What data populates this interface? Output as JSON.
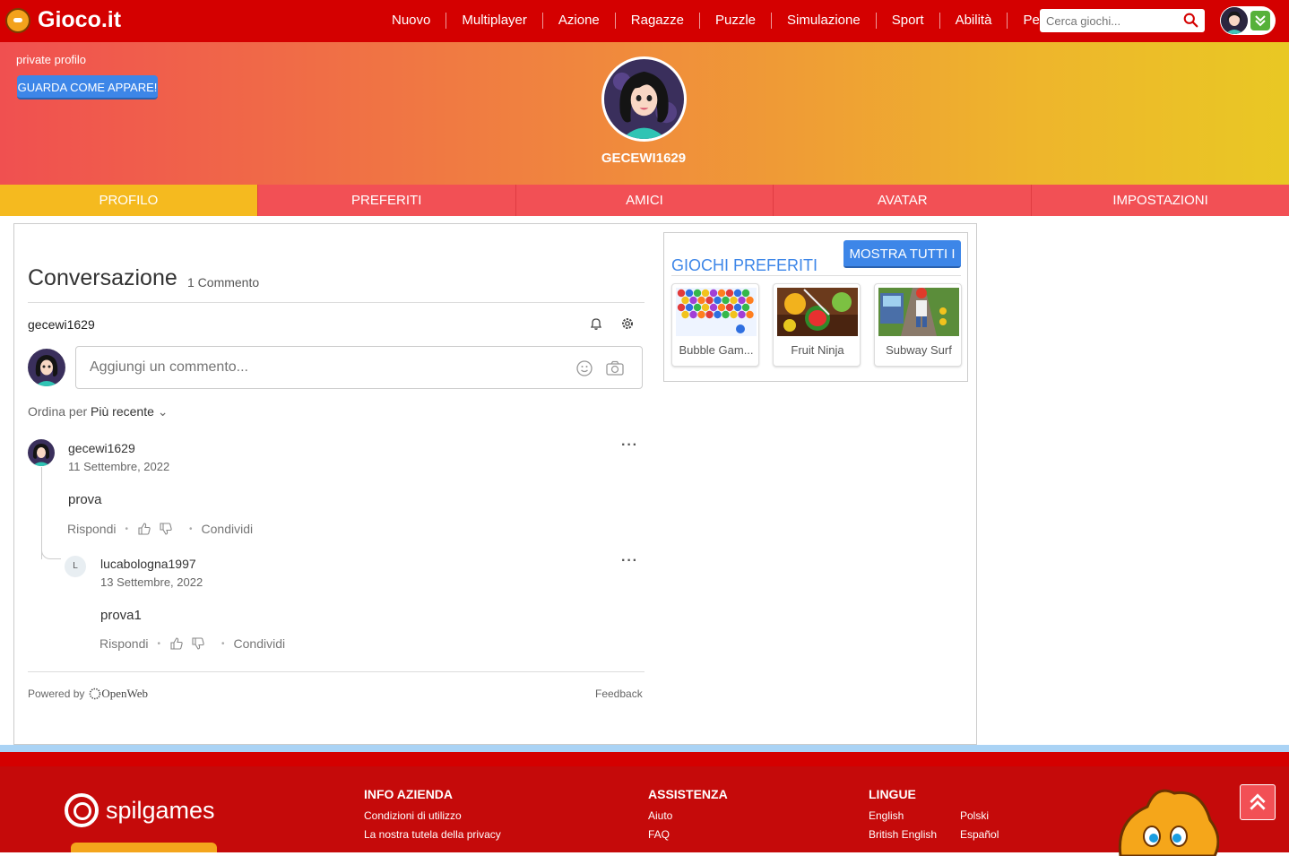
{
  "brand": {
    "name": "Gioco.it"
  },
  "nav": {
    "items": [
      "Nuovo",
      "Multiplayer",
      "Azione",
      "Ragazze",
      "Puzzle",
      "Simulazione",
      "Sport",
      "Abilità",
      "Per te"
    ]
  },
  "search": {
    "placeholder": "Cerca giochi..."
  },
  "hero": {
    "private_label": "private profilo",
    "view_button": "GUARDA COME APPARE!",
    "username": "GECEWI1629"
  },
  "tabs": [
    "PROFILO",
    "PREFERITI",
    "AMICI",
    "AVATAR",
    "IMPOSTAZIONI"
  ],
  "active_tab": "PROFILO",
  "conversation": {
    "title": "Conversazione",
    "count": "1 Commento",
    "current_user": "gecewi1629",
    "input_placeholder": "Aggiungi un commento...",
    "sort_label": "Ordina per",
    "sort_value": "Più recente",
    "comments": [
      {
        "author": "gecewi1629",
        "date": "11 Settembre, 2022",
        "text": "prova",
        "reply": "Rispondi",
        "share": "Condividi"
      },
      {
        "author": "lucabologna1997",
        "initial": "L",
        "date": "13 Settembre, 2022",
        "text": "prova1",
        "reply": "Rispondi",
        "share": "Condividi"
      }
    ],
    "powered_by": "Powered by",
    "provider": "OpenWeb",
    "feedback": "Feedback"
  },
  "favorites": {
    "title": "GIOCHI PREFERITI",
    "show_all": "MOSTRA TUTTI I",
    "games": [
      {
        "name": "Bubble Gam..."
      },
      {
        "name": "Fruit Ninja"
      },
      {
        "name": "Subway Surf"
      }
    ]
  },
  "footer": {
    "spil_brand": "spilgames",
    "info_title": "INFO AZIENDA",
    "info_links": [
      "Condizioni di utilizzo",
      "La nostra tutela della privacy"
    ],
    "help_title": "ASSISTENZA",
    "help_links": [
      "Aiuto",
      "FAQ"
    ],
    "lang_title": "LINGUE",
    "lang_col1": [
      "English",
      "British English"
    ],
    "lang_col2": [
      "Polski",
      "Español"
    ]
  },
  "colors": {
    "topbar": "#d40000",
    "tab": "#f25055",
    "tab_active": "#f5ba1f",
    "accent_blue": "#3d86e8"
  },
  "icons": {
    "search": "search-icon",
    "bell": "bell-icon",
    "gear": "gear-icon",
    "emoji": "emoji-icon",
    "camera": "camera-icon",
    "scroll_top": "chevron-up-icon"
  }
}
